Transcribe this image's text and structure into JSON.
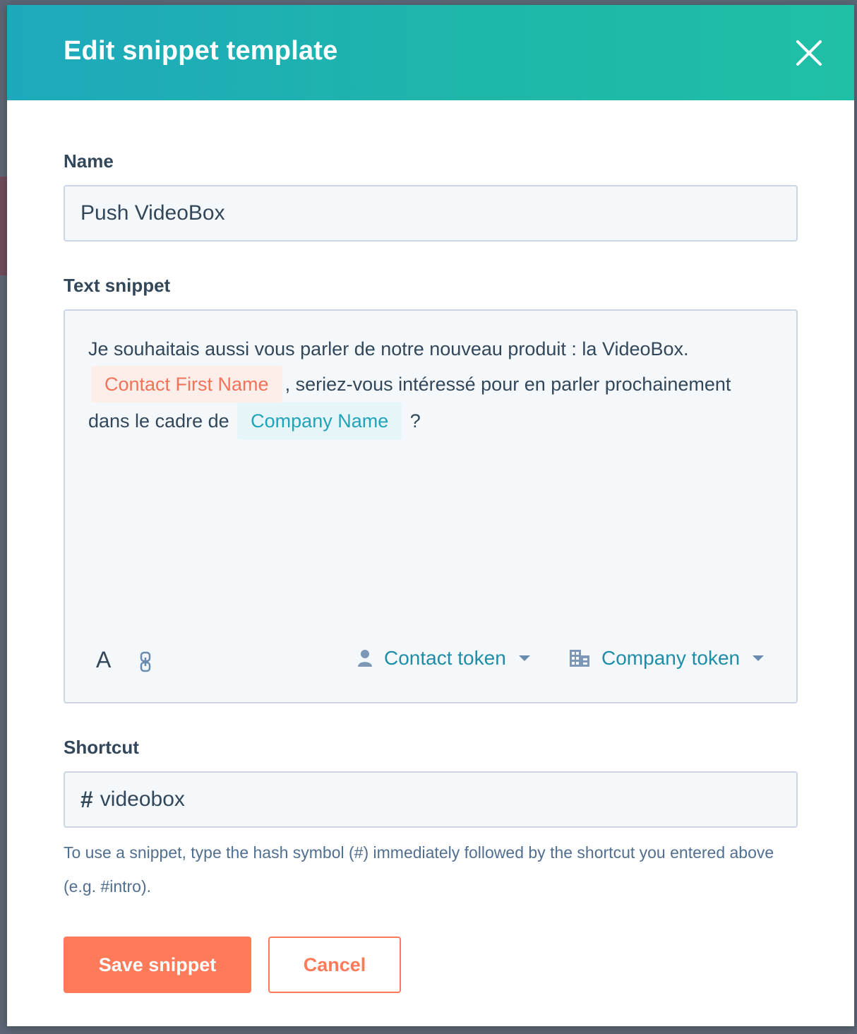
{
  "modal": {
    "title": "Edit snippet template",
    "close_icon": "close-icon"
  },
  "name_field": {
    "label": "Name",
    "value": "Push VideoBox"
  },
  "text_snippet": {
    "label": "Text snippet",
    "text_part1": "Je souhaitais aussi vous parler de notre nouveau produit : la VideoBox.",
    "token_contact": "Contact First Name",
    "text_part2": ", seriez-vous intéressé pour en parler prochainement dans le cadre de",
    "token_company": "Company Name",
    "text_part3": "?"
  },
  "toolbar": {
    "font_button": "A",
    "link_icon": "link-icon",
    "contact_token_label": "Contact token",
    "contact_icon": "person-icon",
    "company_token_label": "Company token",
    "company_icon": "building-icon"
  },
  "shortcut_field": {
    "label": "Shortcut",
    "hash": "#",
    "value": "videobox"
  },
  "help_text": "To use a snippet, type the hash symbol (#) immediately followed by the shortcut you entered above (e.g. #intro).",
  "buttons": {
    "save": "Save snippet",
    "cancel": "Cancel"
  },
  "colors": {
    "header_gradient_start": "#1da9bc",
    "header_gradient_end": "#1fbfa5",
    "primary": "#ff7a59",
    "token_link": "#1e8ea8",
    "text": "#33475b"
  }
}
